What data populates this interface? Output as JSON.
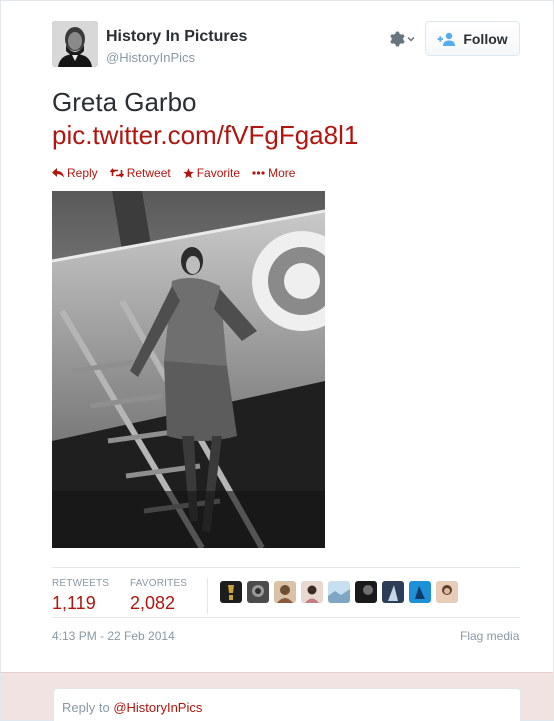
{
  "user": {
    "name": "History In Pictures",
    "handle": "@HistoryInPics",
    "avatar_icon": "portrait-avatar"
  },
  "follow_button": {
    "label": "Follow",
    "icon": "add-user-icon"
  },
  "settings": {
    "icon": "gear-icon"
  },
  "tweet": {
    "text": "Greta Garbo",
    "link": "pic.twitter.com/fVFgFga8l1",
    "image_icon": "photo"
  },
  "actions": [
    {
      "label": "Reply",
      "icon": "reply-icon"
    },
    {
      "label": "Retweet",
      "icon": "retweet-icon"
    },
    {
      "label": "Favorite",
      "icon": "star-icon"
    },
    {
      "label": "More",
      "icon": "more-icon"
    }
  ],
  "stats": {
    "retweets_label": "RETWEETS",
    "retweets_value": "1,119",
    "favorites_label": "FAVORITES",
    "favorites_value": "2,082"
  },
  "timestamp": "4:13 PM - 22 Feb 2014",
  "flag_media": "Flag media",
  "reply": {
    "prefix": "Reply to ",
    "mention": "@HistoryInPics"
  },
  "colors": {
    "link": "#b0150f",
    "muted": "#8899a6",
    "text": "#292f33",
    "reply_bg": "#f2e3e3"
  }
}
